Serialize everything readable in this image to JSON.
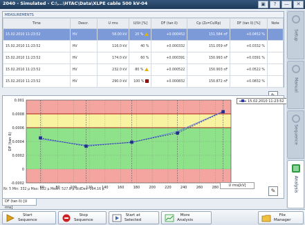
{
  "window": {
    "title": "2040 - Simulated - C:\\...\\HTAC\\Data\\XLPE cable 500 kV-04",
    "buttons": [
      "▣",
      "?",
      "—",
      "✕"
    ]
  },
  "measurements": {
    "heading": "MEASUREMENTS",
    "columns": [
      "Time",
      "Descr.",
      "U rms",
      "U/Ut [%]",
      "DF (tan δ)",
      "Cp (Zs=Cs/Rp)",
      "DF (tan δ) [%]",
      "Note"
    ],
    "rows": [
      {
        "time": "15.02.2010 11:23:52",
        "descr": "HV",
        "urms": "58.00 kV",
        "uut": "20 %",
        "df": "+0.000452",
        "cp": "151.584 nF",
        "dfp": "+0.0452 %",
        "note": "",
        "flag": "warn",
        "selected": true
      },
      {
        "time": "15.02.2010 11:23:52",
        "descr": "HV",
        "urms": "116.0 kV",
        "uut": "40 %",
        "df": "+0.000332",
        "cp": "151.059 nF",
        "dfp": "+0.0332 %",
        "note": "",
        "flag": "",
        "selected": false
      },
      {
        "time": "15.02.2010 11:23:52",
        "descr": "HV",
        "urms": "174.0 kV",
        "uut": "60 %",
        "df": "+0.000391",
        "cp": "150.993 nF",
        "dfp": "+0.0391 %",
        "note": "",
        "flag": "",
        "selected": false
      },
      {
        "time": "15.02.2010 11:23:52",
        "descr": "HV",
        "urms": "232.0 kV",
        "uut": "80 %",
        "df": "+0.000522",
        "cp": "150.903 nF",
        "dfp": "+0.0522 %",
        "note": "",
        "flag": "warn",
        "selected": false
      },
      {
        "time": "15.02.2010 11:23:52",
        "descr": "HV",
        "urms": "290.0 kV",
        "uut": "100 %",
        "df": "+0.000832",
        "cp": "150.872 nF",
        "dfp": "+0.0832 %",
        "note": "",
        "flag": "red",
        "selected": false
      }
    ]
  },
  "chart_panel": {
    "legend": "15.02.2010 11:23:52",
    "stats": "Nr. 5 Min: 332 μ Max: 832 μ Mean: 527.8 μ StdDev: 194.16 μ",
    "x_unit": "U rms[kV]",
    "tab_label": "DF (tan δ) [U rms]"
  },
  "chart_data": {
    "type": "line",
    "ylabel": "DF (tan δ)",
    "xlabel": "U rms[kV]",
    "xlim": [
      40,
      300
    ],
    "ylim": [
      -0.0002,
      0.001
    ],
    "x_ticks": [
      60,
      80,
      100,
      120,
      140,
      160,
      180,
      200,
      220,
      240,
      260,
      280,
      300
    ],
    "y_ticks": [
      0.001,
      0.0008,
      0.0006,
      0.0004,
      0.0002,
      0,
      -0.0002
    ],
    "y_tick_labels": [
      "0.001",
      "0.0008",
      "0.0006",
      "0.0004",
      "0.0002",
      "0",
      "-0.0002"
    ],
    "bands": [
      {
        "from": 0.0008,
        "to": 0.001,
        "color": "#f4a5a0"
      },
      {
        "from": 0.0006,
        "to": 0.0008,
        "color": "#f7f3a0"
      },
      {
        "from": 0.0,
        "to": 0.0006,
        "color": "#8ee38a"
      },
      {
        "from": -0.0002,
        "to": 0.0,
        "color": "#f4a5a0"
      }
    ],
    "threshold_lines": [
      0.0008,
      0.0006
    ],
    "series": [
      {
        "name": "15.02.2010 11:23:52",
        "x": [
          58,
          116,
          174,
          232,
          290
        ],
        "y": [
          0.000452,
          0.000332,
          0.000391,
          0.000522,
          0.000832
        ],
        "trend_y": [
          0.000435,
          0.000345,
          0.000385,
          0.000545,
          0.000835
        ]
      }
    ],
    "vertical_markers": [
      58,
      116,
      174,
      232,
      290
    ],
    "colors": {
      "series": "#20308a",
      "trend": "#6a7de0",
      "threshold": "#b01818"
    }
  },
  "side_tabs": [
    {
      "label": "Setup",
      "active": false
    },
    {
      "label": "Manual",
      "active": false
    },
    {
      "label": "Sequence",
      "active": false
    },
    {
      "label": "Analysis",
      "active": true
    }
  ],
  "toolbar": {
    "start_sequence": "Start\nSequence",
    "stop_sequence": "Stop\nSequence",
    "start_selected": "Start at\nSelected",
    "more_analysis": "More\nAnalysis",
    "file_manager": "File\nManager"
  }
}
